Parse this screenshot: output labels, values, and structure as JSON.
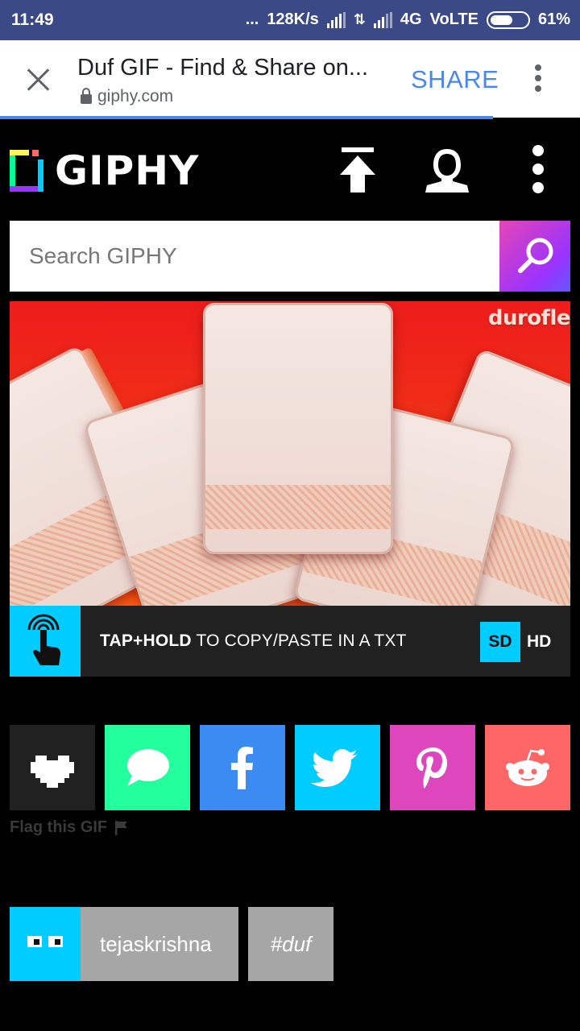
{
  "status_bar": {
    "time": "11:49",
    "dots": "...",
    "speed": "128K/s",
    "network": "4G",
    "volte": "VoLTE",
    "battery": "61%"
  },
  "browser": {
    "title": "Duf GIF - Find & Share on...",
    "url": "giphy.com",
    "share_label": "SHARE"
  },
  "giphy": {
    "logo_text": "GIPHY",
    "search_placeholder": "Search GIPHY",
    "gif_brand_text": "durofle",
    "tap_hold_bold": "TAP+HOLD",
    "tap_hold_rest": " TO COPY/PASTE IN A TXT",
    "sd_label": "SD",
    "hd_label": "HD",
    "share_icons": [
      "heart-icon",
      "message-icon",
      "facebook-icon",
      "twitter-icon",
      "pinterest-icon",
      "reddit-icon"
    ],
    "flag_label": "Flag this GIF",
    "username": "tejaskrishna",
    "tag": "#duf"
  },
  "colors": {
    "status_bar_bg": "#3b4a87",
    "accent_blue": "#4a88e8",
    "giphy_cyan": "#00ccff",
    "giphy_green": "#23ff9c",
    "giphy_purple": "#9933ff",
    "facebook": "#3b8bf2",
    "pinterest": "#dd46bd",
    "reddit": "#ff6666"
  }
}
